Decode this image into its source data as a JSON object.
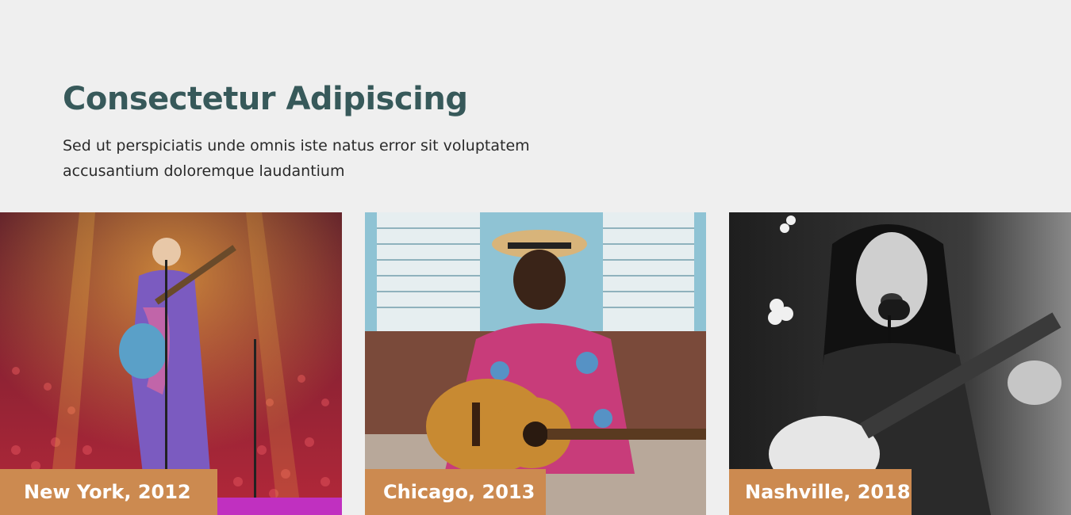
{
  "header": {
    "title": "Consectetur Adipiscing",
    "subtitle": "Sed ut perspiciatis unde omnis iste natus error sit voluptatem accusantium doloremque laudantium"
  },
  "cards": [
    {
      "caption": "New York, 2012",
      "image": "concert-performer-guitar-stage-photo"
    },
    {
      "caption": "Chicago, 2013",
      "image": "street-musician-acoustic-guitar-photo"
    },
    {
      "caption": "Nashville, 2018",
      "image": "singer-guitar-microphone-bw-photo"
    }
  ],
  "colors": {
    "background": "#efefef",
    "title": "#37595a",
    "caption_bg": "#cc8a50",
    "caption_text": "#ffffff"
  }
}
